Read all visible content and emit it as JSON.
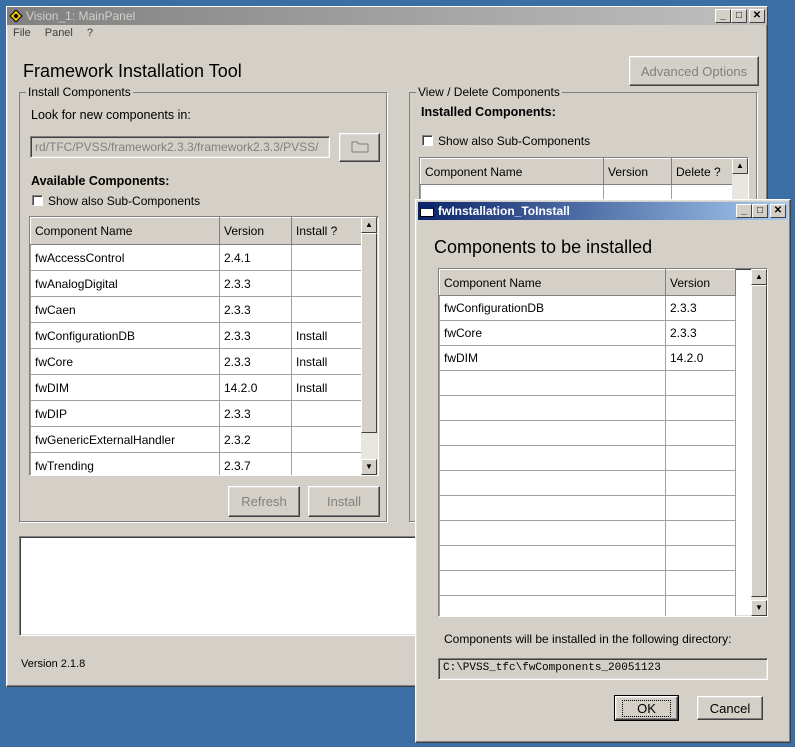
{
  "main_window": {
    "title": "Vision_1: MainPanel",
    "menu": [
      "File",
      "Panel",
      "?"
    ],
    "heading": "Framework Installation Tool",
    "advanced_options_label": "Advanced Options",
    "version_label": "Version 2.1.8",
    "install_group": {
      "legend": "Install Components",
      "look_for_label": "Look for new components in:",
      "path_value": "rd/TFC/PVSS/framework2.3.3/framework2.3.3/PVSS/",
      "available_label": "Available Components:",
      "show_sub_label": "Show also Sub-Components",
      "columns": [
        "Component Name",
        "Version",
        "Install ?"
      ],
      "rows": [
        [
          "fwAccessControl",
          "2.4.1",
          ""
        ],
        [
          "fwAnalogDigital",
          "2.3.3",
          ""
        ],
        [
          "fwCaen",
          "2.3.3",
          ""
        ],
        [
          "fwConfigurationDB",
          "2.3.3",
          "Install"
        ],
        [
          "fwCore",
          "2.3.3",
          "Install"
        ],
        [
          "fwDIM",
          "14.2.0",
          "Install"
        ],
        [
          "fwDIP",
          "2.3.3",
          ""
        ],
        [
          "fwGenericExternalHandler",
          "2.3.2",
          ""
        ],
        [
          "fwTrending",
          "2.3.7",
          ""
        ]
      ],
      "refresh_label": "Refresh",
      "install_label": "Install"
    },
    "view_group": {
      "legend": "View / Delete Components",
      "installed_label": "Installed Components:",
      "show_sub_label": "Show also Sub-Components",
      "columns": [
        "Component Name",
        "Version",
        "Delete ?"
      ]
    }
  },
  "dialog": {
    "title": "fwInstallation_ToInstall",
    "heading": "Components to be installed",
    "columns": [
      "Component Name",
      "Version"
    ],
    "rows": [
      [
        "fwConfigurationDB",
        "2.3.3"
      ],
      [
        "fwCore",
        "2.3.3"
      ],
      [
        "fwDIM",
        "14.2.0"
      ],
      [
        "",
        ""
      ],
      [
        "",
        ""
      ],
      [
        "",
        ""
      ],
      [
        "",
        ""
      ],
      [
        "",
        ""
      ],
      [
        "",
        ""
      ],
      [
        "",
        ""
      ],
      [
        "",
        ""
      ],
      [
        "",
        ""
      ],
      [
        "",
        ""
      ]
    ],
    "dir_label": "Components will be installed in the following directory:",
    "dir_value": "C:\\PVSS_tfc\\fwComponents_20051123",
    "ok_label": "OK",
    "cancel_label": "Cancel"
  }
}
